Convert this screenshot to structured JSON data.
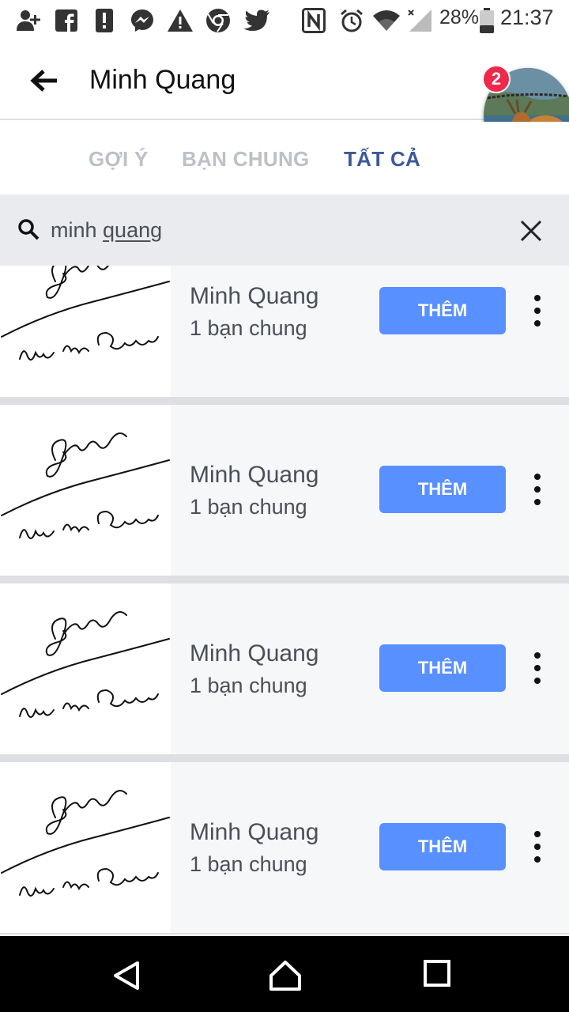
{
  "status_bar": {
    "battery": "28%",
    "time": "21:37",
    "icons": [
      "add-friend-icon",
      "facebook-icon",
      "alert-icon",
      "messenger-icon",
      "warning-icon",
      "chrome-icon",
      "twitter-icon",
      "nfc-icon",
      "alarm-icon",
      "wifi-icon",
      "signal-icon",
      "battery-icon"
    ]
  },
  "header": {
    "title": "Minh Quang",
    "back_icon": "arrow-left-icon"
  },
  "chat_head": {
    "badge_count": "2"
  },
  "tabs": [
    {
      "label": "GỢI Ý",
      "active": false
    },
    {
      "label": "BẠN CHUNG",
      "active": false
    },
    {
      "label": "TẤT CẢ",
      "active": true
    }
  ],
  "search": {
    "query_part1": "minh ",
    "query_part2": "quang",
    "search_icon": "search-icon",
    "clear_icon": "close-icon"
  },
  "results": [
    {
      "name": "Minh Quang",
      "mutual": "1 bạn chung",
      "button": "THÊM"
    },
    {
      "name": "Minh Quang",
      "mutual": "1 bạn chung",
      "button": "THÊM"
    },
    {
      "name": "Minh Quang",
      "mutual": "1 bạn chung",
      "button": "THÊM"
    },
    {
      "name": "Minh Quang",
      "mutual": "1 bạn chung",
      "button": "THÊM"
    }
  ],
  "colors": {
    "accent": "#3b5998",
    "button": "#5890ff",
    "badge": "#f0284a"
  },
  "nav_bar": {
    "icons": [
      "back-triangle-icon",
      "home-icon",
      "recents-icon"
    ]
  }
}
